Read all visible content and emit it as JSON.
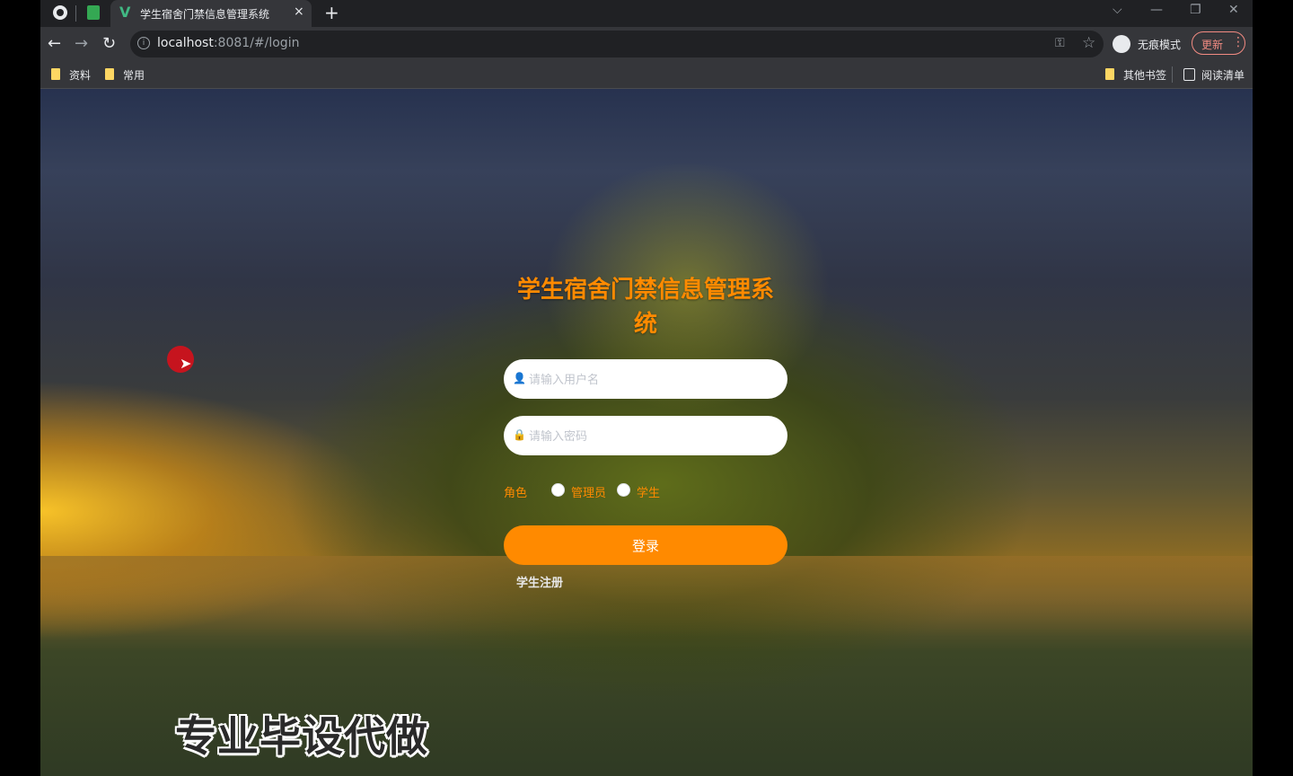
{
  "browser": {
    "tab": {
      "title": "学生宿舍门禁信息管理系统",
      "close": "×",
      "new_tab": "+"
    },
    "window_controls": {
      "tabs_menu": "⌵",
      "minimize": "—",
      "restore": "❐",
      "close": "✕"
    },
    "nav": {
      "back": "←",
      "forward": "→",
      "reload": "↻"
    },
    "url": {
      "host": "localhost",
      "rest": ":8081/#/login"
    },
    "incognito_label": "无痕模式",
    "update_label": "更新",
    "bookmarks": [
      {
        "label": "资料"
      },
      {
        "label": "常用"
      }
    ],
    "other_bookmarks": "其他书签",
    "reading_list": "阅读清单"
  },
  "login": {
    "title": "学生宿舍门禁信息管理系统",
    "username_placeholder": "请输入用户名",
    "password_placeholder": "请输入密码",
    "role_label": "角色",
    "roles": [
      "管理员",
      "学生"
    ],
    "login_button": "登录",
    "register_link": "学生注册"
  },
  "overlay": {
    "watermark": "专业毕设代做"
  },
  "colors": {
    "accent": "#ff8a00",
    "cursor_marker": "#c6141e"
  },
  "icons": {
    "user": "user-icon",
    "lock": "lock-icon"
  }
}
